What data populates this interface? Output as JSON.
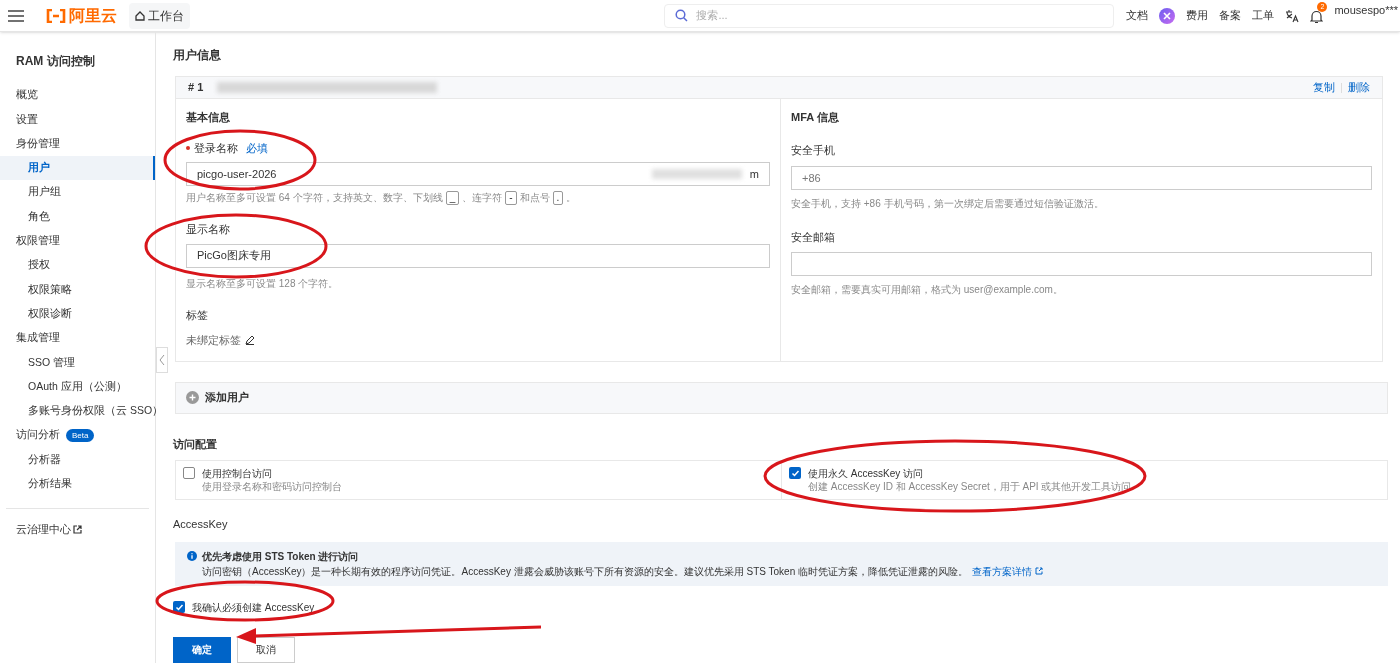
{
  "topbar": {
    "logo": "阿里云",
    "workbench": "工作台",
    "search": {
      "placeholder": "搜索..."
    },
    "links": [
      {
        "kind": "text",
        "label": "文档"
      },
      {
        "kind": "ai"
      },
      {
        "kind": "text",
        "label": "费用"
      },
      {
        "kind": "text",
        "label": "备案"
      },
      {
        "kind": "text",
        "label": "工单"
      },
      {
        "kind": "translate"
      },
      {
        "kind": "bell",
        "badge": "2"
      }
    ],
    "user": "mousespo***"
  },
  "sidebar": {
    "title": "RAM 访问控制",
    "items": [
      {
        "label": "概览",
        "selected": false
      },
      {
        "label": "设置",
        "selected": false
      },
      {
        "label": "身份管理",
        "selected": false,
        "children": [
          {
            "label": "用户",
            "selected": true
          },
          {
            "label": "用户组",
            "selected": false
          },
          {
            "label": "角色",
            "selected": false
          }
        ]
      },
      {
        "label": "权限管理",
        "selected": false,
        "children": [
          {
            "label": "授权",
            "selected": false
          },
          {
            "label": "权限策略",
            "selected": false
          },
          {
            "label": "权限诊断",
            "selected": false
          }
        ]
      },
      {
        "label": "集成管理",
        "selected": false,
        "children": [
          {
            "label": "SSO 管理",
            "selected": false
          },
          {
            "label": "OAuth 应用（公测）",
            "selected": false
          },
          {
            "label": "多账号身份权限（云 SSO）",
            "selected": false
          }
        ]
      },
      {
        "label": "访问分析",
        "selected": false,
        "badge": "Beta",
        "children": [
          {
            "label": "分析器",
            "selected": false
          },
          {
            "label": "分析结果",
            "selected": false
          }
        ]
      }
    ],
    "footer_link": "云治理中心"
  },
  "user_info": {
    "title": "用户信息",
    "card": {
      "index": "# 1",
      "actions": [
        "复制",
        "删除"
      ],
      "basic": {
        "title": "基本信息",
        "login_name": {
          "label": "登录名称",
          "required": true,
          "required_hint": "必填",
          "value": "picgo-user-2026",
          "suffix": "m",
          "hint": [
            {
              "kind": "text",
              "text": "用户名称至多可设置 64 个字符，支持英文、数字、下划线"
            },
            {
              "kind": "key",
              "text": "_"
            },
            {
              "kind": "text",
              "text": "、连字符"
            },
            {
              "kind": "key",
              "text": "-"
            },
            {
              "kind": "text",
              "text": "和点号"
            },
            {
              "kind": "key",
              "text": "."
            },
            {
              "kind": "text",
              "text": "。"
            }
          ]
        },
        "display_name": {
          "label": "显示名称",
          "value": "PicGo图床专用",
          "hint": "显示名称至多可设置 128 个字符。"
        },
        "tags": {
          "label": "标签",
          "value": "未绑定标签"
        }
      },
      "mfa": {
        "title": "MFA 信息",
        "phone": {
          "label": "安全手机",
          "placeholder": "+86",
          "hint": "安全手机，支持 +86 手机号码，第一次绑定后需要通过短信验证激活。"
        },
        "email": {
          "label": "安全邮箱",
          "hint": "安全邮箱，需要真实可用邮箱，格式为 user@example.com。"
        }
      }
    },
    "add_user": "添加用户"
  },
  "access_config": {
    "title": "访问配置",
    "options": [
      {
        "label": "使用控制台访问",
        "description": "使用登录名称和密码访问控制台",
        "checked": false
      },
      {
        "label": "使用永久 AccessKey 访问",
        "description": "创建 AccessKey ID 和 AccessKey Secret，用于 API 或其他开发工具访问",
        "checked": true
      }
    ]
  },
  "accesskey": {
    "title": "AccessKey",
    "notice": {
      "title": "优先考虑使用 STS Token 进行访问",
      "text": "访问密钥（AccessKey）是一种长期有效的程序访问凭证。AccessKey 泄露会威胁该账号下所有资源的安全。建议优先采用 STS Token 临时凭证方案，降低凭证泄露的风险。",
      "link": "查看方案详情"
    },
    "confirm": {
      "label": "我确认必须创建 AccessKey",
      "checked": true
    }
  },
  "buttons": [
    {
      "label": "确定",
      "kind": "primary"
    },
    {
      "label": "取消",
      "kind": "default"
    }
  ]
}
